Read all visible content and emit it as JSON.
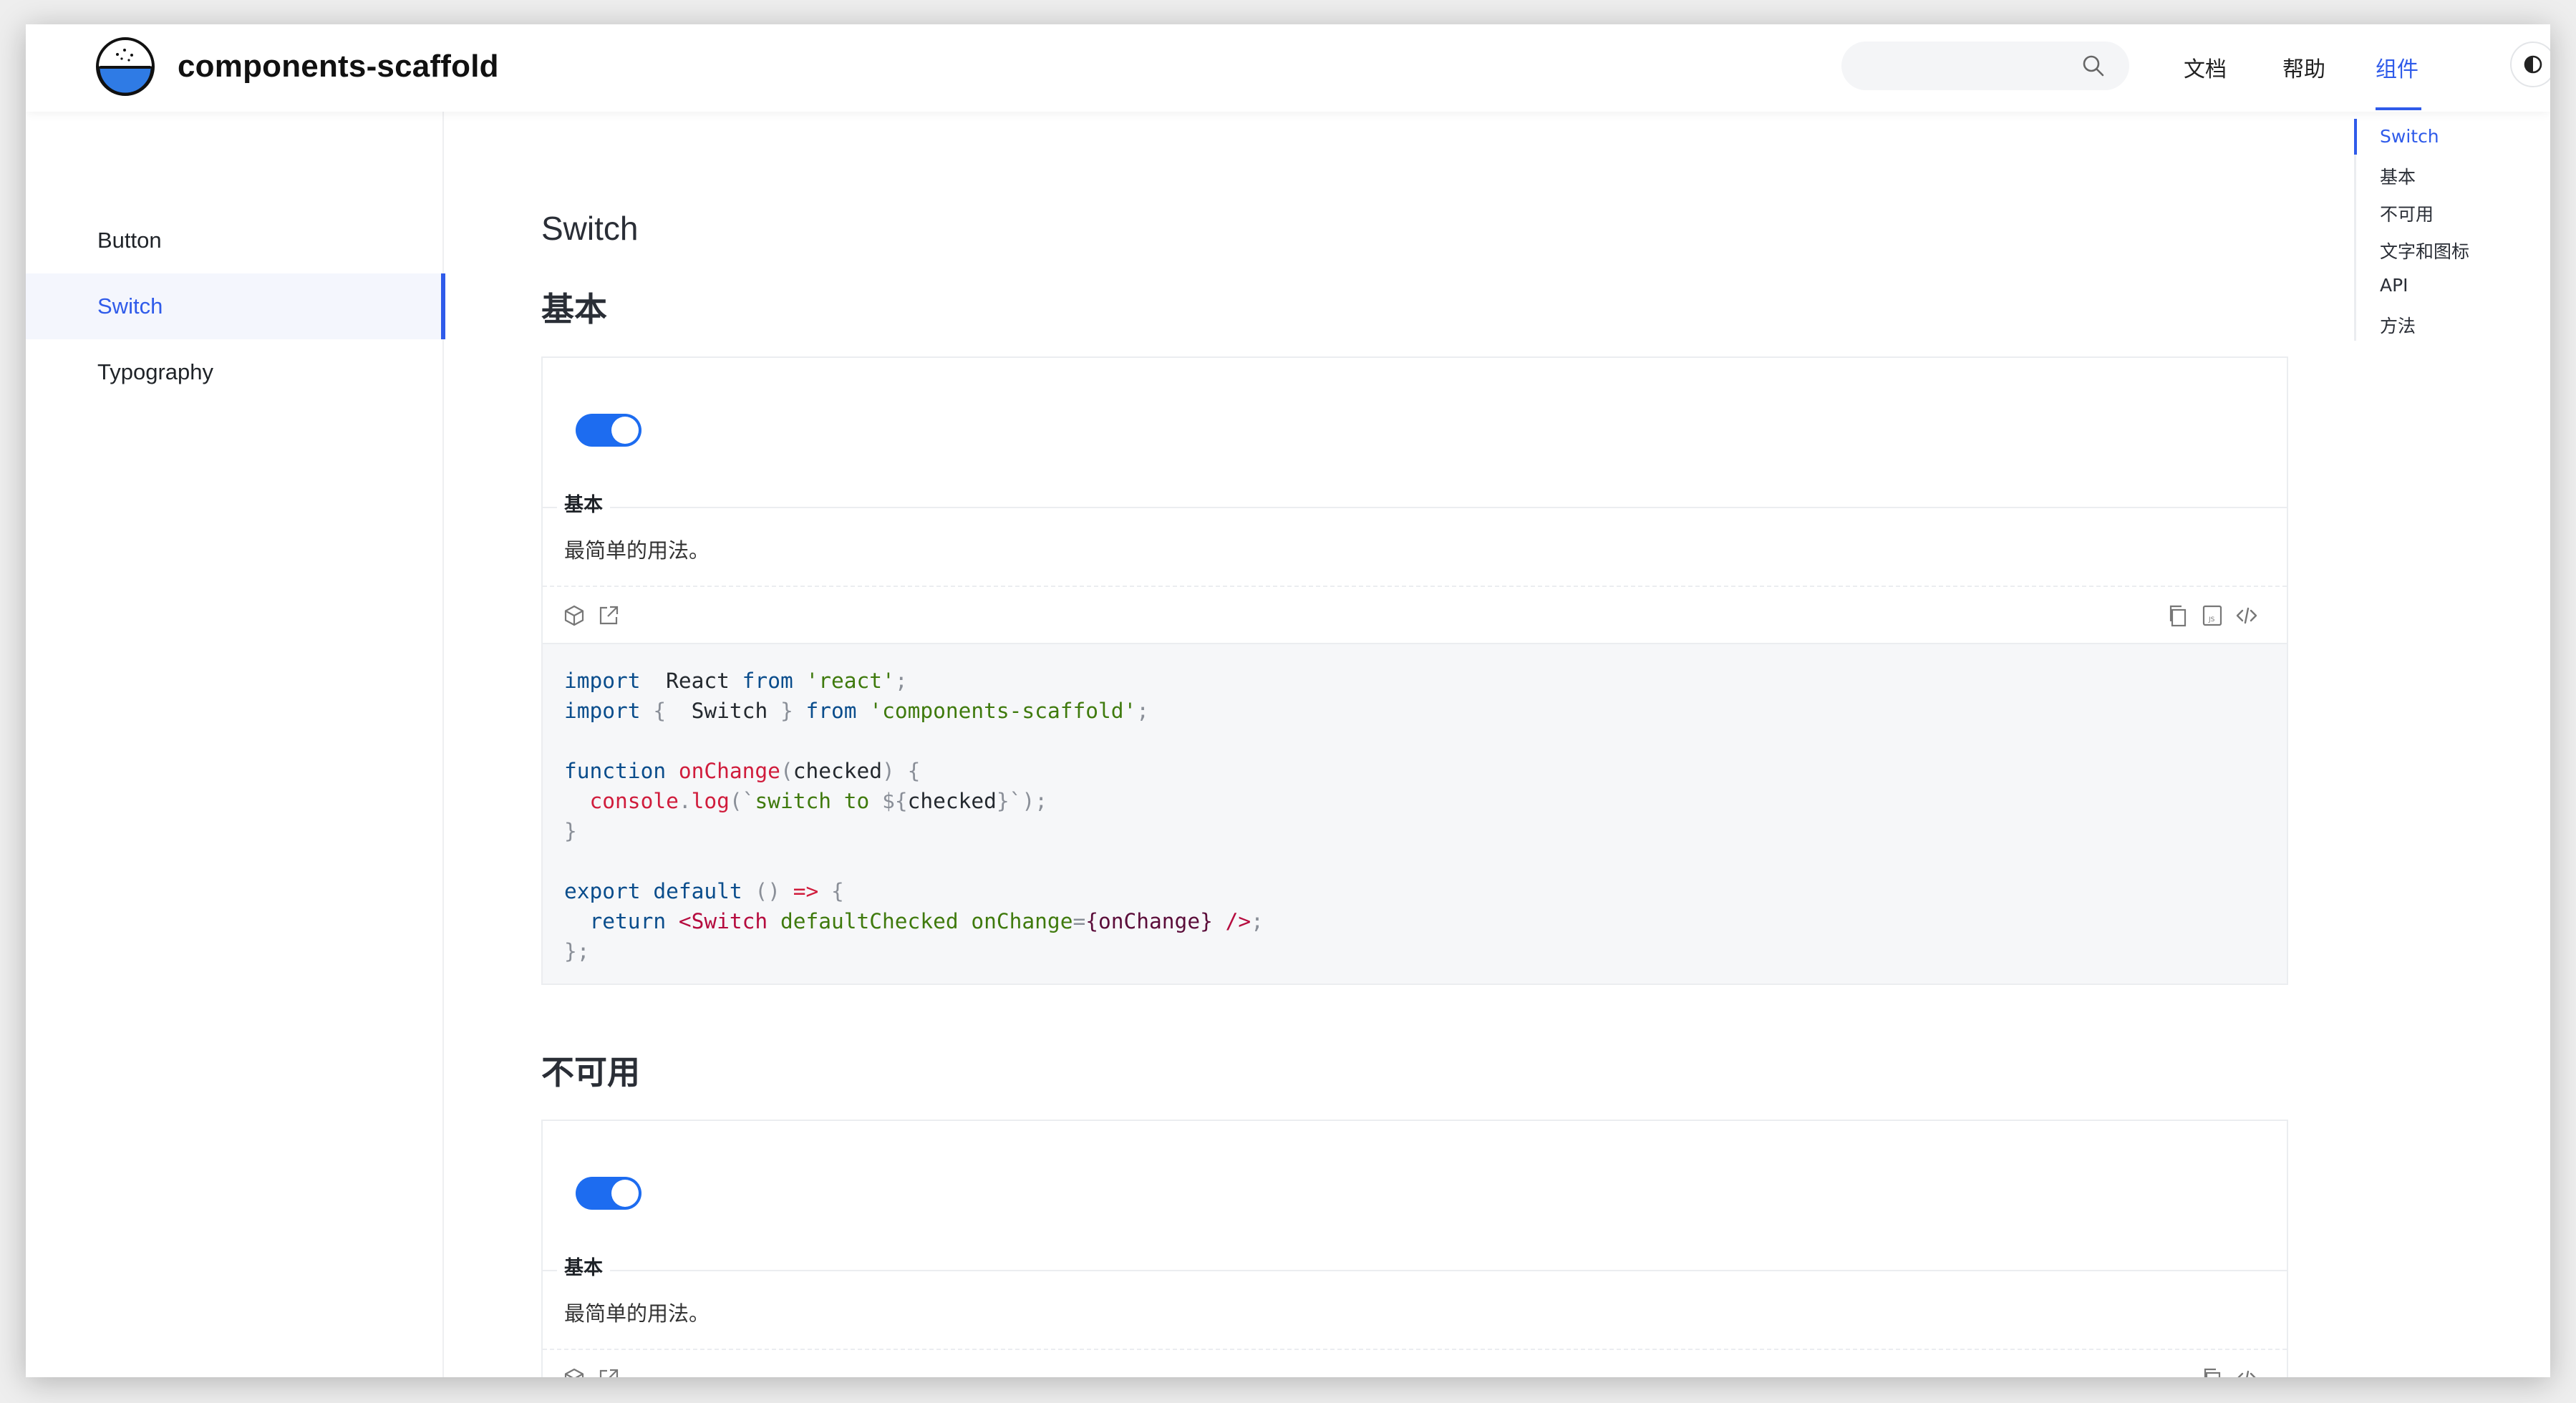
{
  "header": {
    "site_title": "components-scaffold",
    "search": {
      "placeholder": ""
    },
    "nav": [
      {
        "label": "文档",
        "active": false
      },
      {
        "label": "帮助",
        "active": false
      },
      {
        "label": "组件",
        "active": true
      }
    ]
  },
  "sidebar": {
    "items": [
      {
        "label": "Button",
        "active": false
      },
      {
        "label": "Switch",
        "active": true
      },
      {
        "label": "Typography",
        "active": false
      }
    ]
  },
  "main": {
    "page_title": "Switch",
    "sections": [
      {
        "title": "基本",
        "switch_checked": true,
        "demo_label": "基本",
        "demo_desc": "最简单的用法。",
        "code_lines": [
          [
            [
              "k",
              "import"
            ],
            [
              "",
              "  React "
            ],
            [
              "k",
              "from"
            ],
            [
              "s",
              " 'react'"
            ],
            [
              "p",
              ";"
            ]
          ],
          [
            [
              "k",
              "import"
            ],
            [
              "p",
              " { "
            ],
            [
              "",
              " Switch "
            ],
            [
              "p",
              "} "
            ],
            [
              "k",
              "from"
            ],
            [
              "s",
              " 'components-scaffold'"
            ],
            [
              "p",
              ";"
            ]
          ],
          [],
          [
            [
              "k",
              "function"
            ],
            [
              "f",
              " onChange"
            ],
            [
              "p",
              "("
            ],
            [
              "",
              "checked"
            ],
            [
              "p",
              ") {"
            ]
          ],
          [
            [
              "f",
              "  console"
            ],
            [
              "p",
              "."
            ],
            [
              "f",
              "log"
            ],
            [
              "p",
              "(`"
            ],
            [
              "s",
              "switch to "
            ],
            [
              "p",
              "${"
            ],
            [
              "",
              "checked"
            ],
            [
              "p",
              "}`);"
            ]
          ],
          [
            [
              "p",
              "}"
            ]
          ],
          [],
          [
            [
              "k",
              "export"
            ],
            [
              "k",
              " default"
            ],
            [
              "p",
              " () "
            ],
            [
              "f",
              "=>"
            ],
            [
              "p",
              " {"
            ]
          ],
          [
            [
              "k",
              "  return"
            ],
            [
              "t",
              " <Switch"
            ],
            [
              "a",
              " defaultChecked"
            ],
            [
              "a",
              " onChange"
            ],
            [
              "p",
              "="
            ],
            [
              "v",
              "{onChange}"
            ],
            [
              "t",
              " />"
            ],
            [
              "p",
              ";"
            ]
          ],
          [
            [
              "p",
              "};"
            ]
          ]
        ]
      },
      {
        "title": "不可用",
        "switch_checked": true,
        "demo_label": "基本",
        "demo_desc": "最简单的用法。"
      }
    ]
  },
  "toc": {
    "items": [
      {
        "label": "Switch",
        "active": true
      },
      {
        "label": "基本",
        "active": false
      },
      {
        "label": "不可用",
        "active": false
      },
      {
        "label": "文字和图标",
        "active": false
      },
      {
        "label": "API",
        "active": false
      },
      {
        "label": "方法",
        "active": false
      }
    ]
  },
  "colors": {
    "accent": "#2f5bea",
    "switch_on": "#1d6cf0",
    "code_bg": "#f6f7f9"
  },
  "icons": {
    "codesandbox": "cube-icon",
    "open_external": "external-link-icon",
    "copy": "copy-icon",
    "js_toggle": "js-file-icon",
    "code_toggle": "code-icon",
    "search": "search-icon",
    "theme": "theme-contrast-icon",
    "logo": "rice-bowl-logo"
  }
}
